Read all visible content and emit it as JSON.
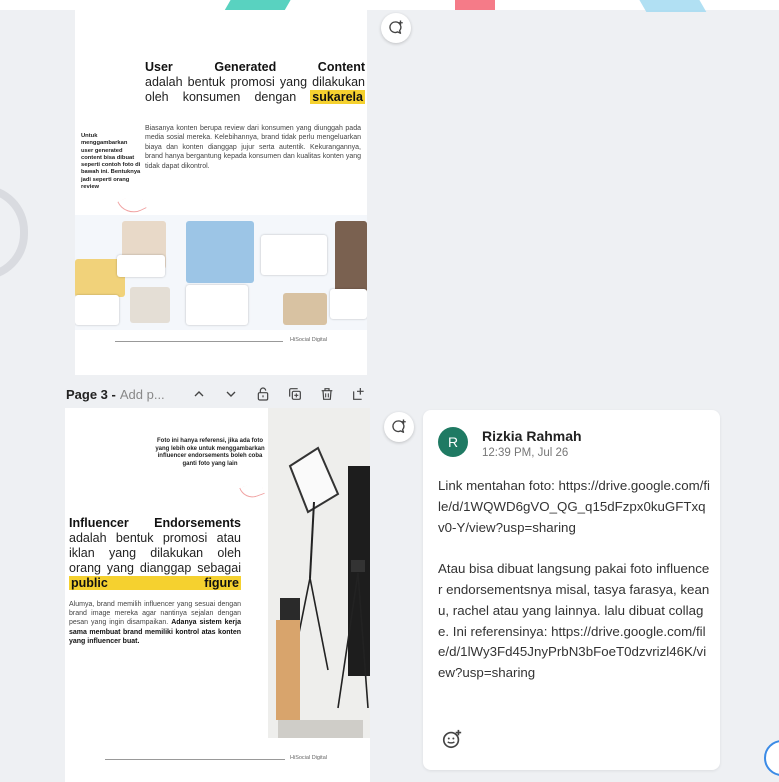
{
  "slide2": {
    "heading_title": "User Generated Content",
    "heading_body": "adalah bentuk promosi yang dilakukan oleh konsumen dengan",
    "heading_highlight": "sukarela",
    "side_note": "Untuk menggambarkan user generated content bisa dibuat seperti contoh foto di bawah ini. Bentuknya jadi seperti orang review",
    "description": "Biasanya konten berupa review dari konsumen yang diunggah pada media sosial mereka. Kelebihannya, brand tidak perlu mengeluarkan biaya dan konten dianggap jujur serta autentik. Kekurangannya, brand hanya bergantung kepada konsumen dan kualitas konten yang tidak dapat dikontrol.",
    "footer": "HiSocial Digital"
  },
  "toolbar": {
    "page_label": "Page 3 -",
    "page_title_placeholder": "Add p..."
  },
  "slide3": {
    "note": "Foto ini hanya referensi, jika ada foto yang lebih oke untuk menggambarkan influencer endorsements boleh coba ganti foto yang lain",
    "heading_title": "Influencer Endorsements",
    "heading_body": "adalah bentuk promosi atau iklan yang dilakukan oleh orang yang dianggap sebagai",
    "heading_highlight": "public figure",
    "description_plain": "Alumya, brand memilih influencer yang sesuai dengan brand image mereka agar nantinya sejalan dengan pesan yang ingin disampaikan.",
    "description_bold": "Adanya sistem kerja sama membuat brand memiliki kontrol atas konten yang influencer buat.",
    "footer": "HiSocial Digital"
  },
  "comment": {
    "avatar_initial": "R",
    "author": "Rizkia Rahmah",
    "timestamp": "12:39 PM, Jul 26",
    "paragraph1": "Link mentahan foto: https://drive.google.com/file/d/1WQWD6gVO_QG_q15dFzpx0kuGFTxqv0-Y/view?usp=sharing",
    "paragraph2": "Atau bisa dibuat langsung pakai foto influencer endorsementsnya misal, tasya farasya, keanu, rachel atau yang lainnya. lalu dibuat collage. Ini referensinya: https://drive.google.com/file/d/1lWy3Fd45JnyPrbN3bFoeT0dzvrizl46K/view?usp=sharing"
  },
  "colors": {
    "highlight": "#f5d12f",
    "avatar": "#1f7a63",
    "background": "#eef0f3"
  }
}
